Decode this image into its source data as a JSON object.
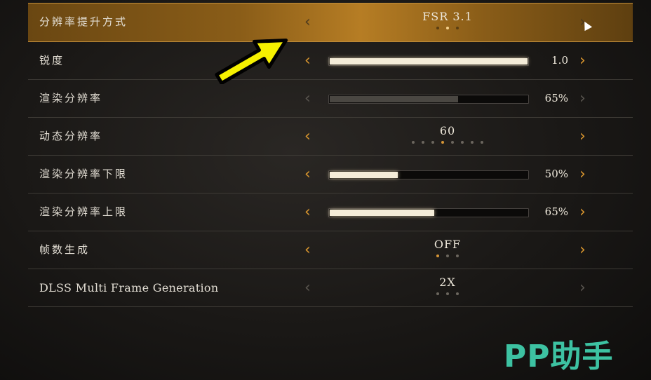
{
  "settings": [
    {
      "label": "分辨率提升方式",
      "type": "option",
      "value": "FSR 3.1",
      "dots": 3,
      "active_dot": 1,
      "selected": true,
      "left_enabled": false,
      "right_enabled": true
    },
    {
      "label": "锐度",
      "type": "slider",
      "value": "1.0",
      "fill": 1.0,
      "enabled": true
    },
    {
      "label": "渲染分辨率",
      "type": "slider",
      "value": "65%",
      "fill": 0.65,
      "enabled": false
    },
    {
      "label": "动态分辨率",
      "type": "option",
      "value": "60",
      "dots": 8,
      "active_dot": 3,
      "selected": false,
      "left_enabled": true,
      "right_enabled": true
    },
    {
      "label": "渲染分辨率下限",
      "type": "slider",
      "value": "50%",
      "fill": 0.345,
      "enabled": true
    },
    {
      "label": "渲染分辨率上限",
      "type": "slider",
      "value": "65%",
      "fill": 0.53,
      "enabled": true
    },
    {
      "label": "帧数生成",
      "type": "option",
      "value": "OFF",
      "dots": 3,
      "active_dot": 0,
      "selected": false,
      "left_enabled": true,
      "right_enabled": true
    },
    {
      "label": "DLSS Multi Frame Generation",
      "type": "option",
      "value": "2X",
      "dots": 3,
      "active_dot": -1,
      "selected": false,
      "left_enabled": false,
      "right_enabled": false
    }
  ],
  "watermark": "PP助手",
  "colors": {
    "accent": "#d9962e",
    "selected_row": "#b67d24",
    "callout": "#f5f000",
    "watermark": "#3dc2a2"
  },
  "icons": {
    "left_arrow": "‹",
    "right_arrow": "›"
  }
}
